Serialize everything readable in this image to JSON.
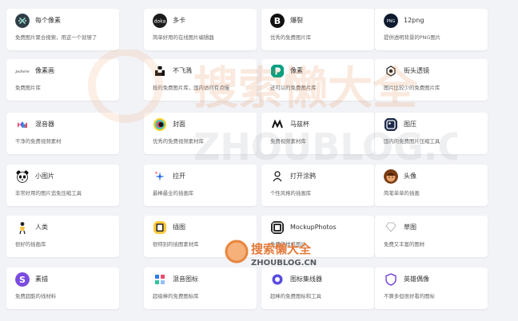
{
  "cards": [
    {
      "name": "每个像素",
      "desc": "免费图片聚合搜索，用这一个就够了",
      "icon": "cross-dots-icon"
    },
    {
      "name": "多卡",
      "desc": "简单好用的在线图片编辑器",
      "icon": "doka-icon"
    },
    {
      "name": "爆裂",
      "desc": "优秀的免费图片库",
      "icon": "burst-b-icon"
    },
    {
      "name": "12png",
      "desc": "提供透明背景的PNG图片",
      "icon": "png-icon"
    },
    {
      "name": "像素画",
      "desc": "免费图片库",
      "icon": "pxhere-icon"
    },
    {
      "name": "不飞溅",
      "desc": "极的免费图片库，国内访问有点慢",
      "icon": "unsplash-icon"
    },
    {
      "name": "像素",
      "desc": "还可以的免费图片库",
      "icon": "pexels-icon"
    },
    {
      "name": "街头透镜",
      "desc": "图片比较少的免费图片库",
      "icon": "streetlens-icon"
    },
    {
      "name": "混音器",
      "desc": "干净的免费视频素材",
      "icon": "mixkit-icon"
    },
    {
      "name": "封面",
      "desc": "优秀的免费视频素材库",
      "icon": "coverr-icon"
    },
    {
      "name": "马兹杯",
      "desc": "免费视频素材库",
      "icon": "mazwai-icon"
    },
    {
      "name": "图压",
      "desc": "国内的免费图片压缩工具",
      "icon": "tuya-icon"
    },
    {
      "name": "小图片",
      "desc": "非常好用的图片追免压缩工具",
      "icon": "panda-icon"
    },
    {
      "name": "拉开",
      "desc": "最棒最全的插画库",
      "icon": "lakai-icon"
    },
    {
      "name": "打开涂鸦",
      "desc": "个性风格的插画库",
      "icon": "opendoodles-icon"
    },
    {
      "name": "头像",
      "desc": "简笔单单的插画",
      "icon": "avatar-face-icon"
    },
    {
      "name": "人类",
      "desc": "很好的插画库",
      "icon": "humaaans-icon"
    },
    {
      "name": "插图",
      "desc": "很特别的插图素材库",
      "icon": "illustration-icon"
    },
    {
      "name": "MockupPhotos",
      "desc": "免费的样机图片",
      "icon": "mockup-icon"
    },
    {
      "name": "草图",
      "desc": "免费又丰富的图材",
      "icon": "sketch-icon"
    },
    {
      "name": "素描",
      "desc": "免费超酷的线材料",
      "icon": "sumiao-icon"
    },
    {
      "name": "混音图标",
      "desc": "超级棒的免费图标库",
      "icon": "mix-icons-icon"
    },
    {
      "name": "图标集线器",
      "desc": "超棒的免费图标和工具",
      "icon": "iconhub-icon"
    },
    {
      "name": "英雄偶像",
      "desc": "不算多但很好看的图标",
      "icon": "heroicons-icon"
    }
  ],
  "watermark": {
    "brand": "搜索懒大全",
    "url": "ZHOUBLOG.CN"
  }
}
